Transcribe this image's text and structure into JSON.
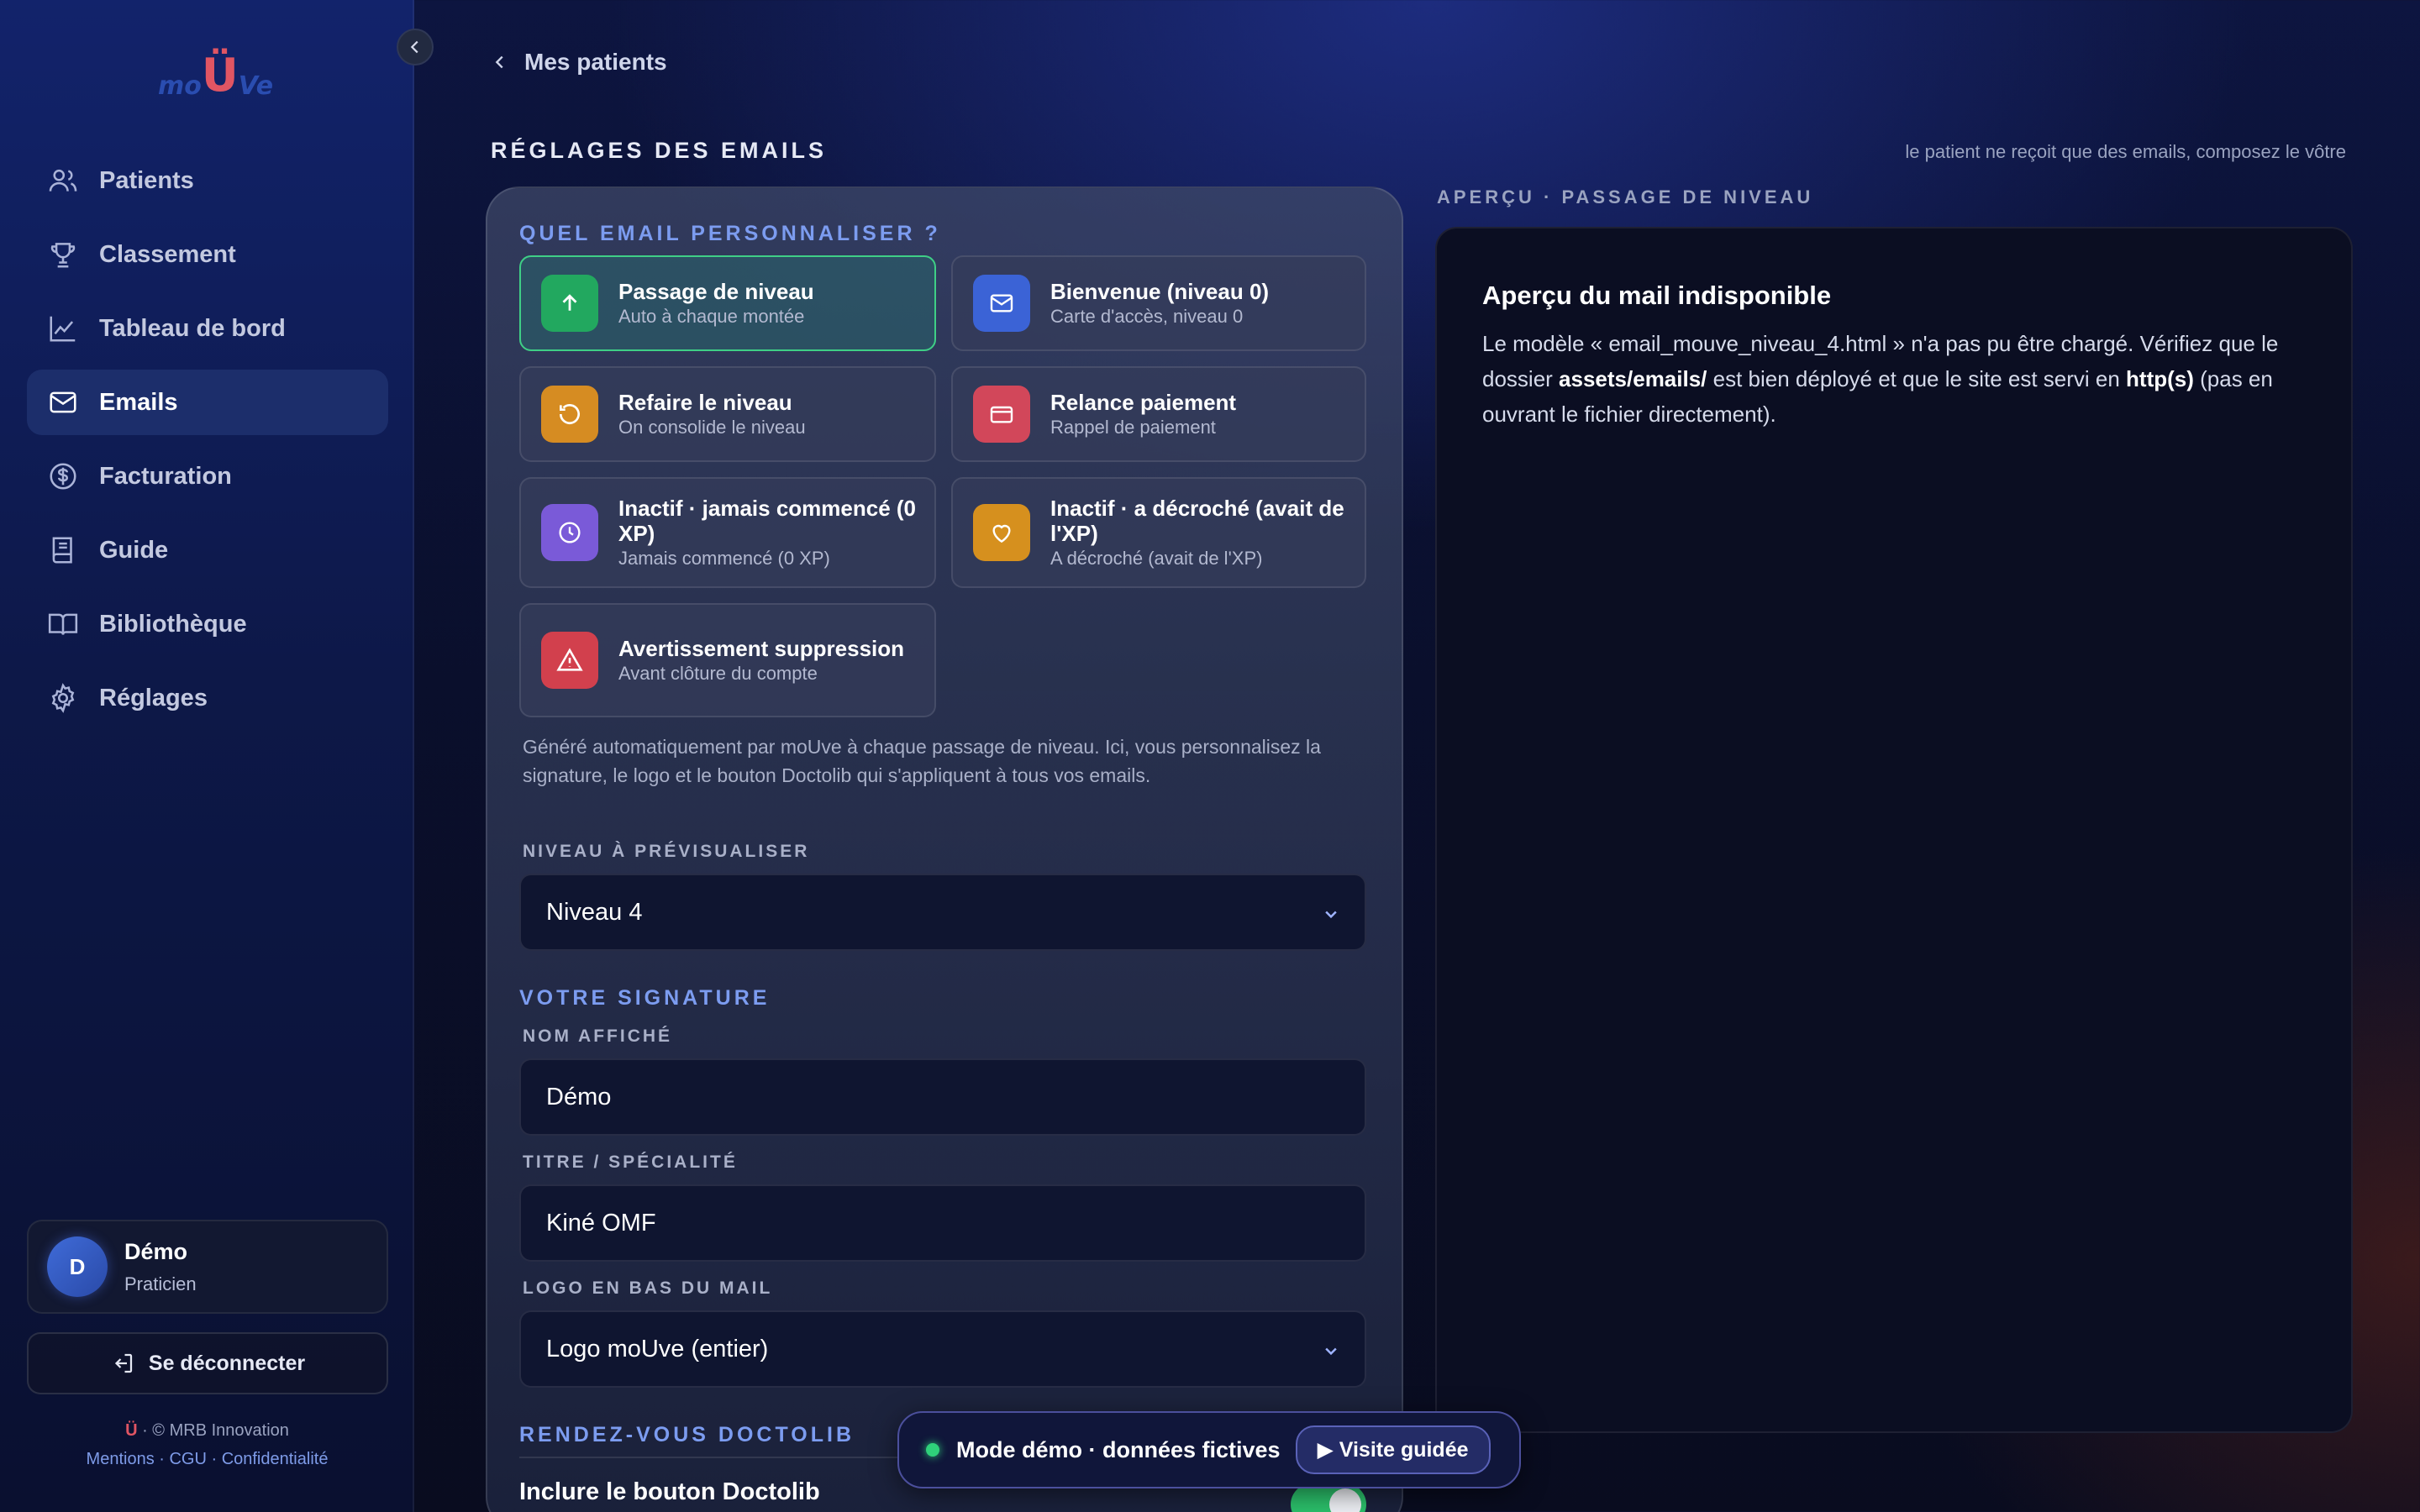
{
  "app": {
    "logo_text_left": "mo",
    "logo_text_mid": "Ü",
    "logo_text_right": "Ve"
  },
  "sidebar": {
    "items": [
      {
        "label": "Patients",
        "icon": "users-icon"
      },
      {
        "label": "Classement",
        "icon": "trophy-icon"
      },
      {
        "label": "Tableau de bord",
        "icon": "chart-icon"
      },
      {
        "label": "Emails",
        "icon": "mail-icon",
        "active": true
      },
      {
        "label": "Facturation",
        "icon": "dollar-icon"
      },
      {
        "label": "Guide",
        "icon": "book-icon"
      },
      {
        "label": "Bibliothèque",
        "icon": "open-book-icon"
      },
      {
        "label": "Réglages",
        "icon": "gear-icon"
      }
    ],
    "user": {
      "initial": "D",
      "name": "Démo",
      "role": "Praticien"
    },
    "logout": "Se déconnecter",
    "footer": {
      "copyright": "· © MRB Innovation",
      "links": "Mentions · CGU · Confidentialité"
    }
  },
  "header": {
    "back_label": "Mes patients",
    "title": "RÉGLAGES DES EMAILS",
    "hint": "le patient ne reçoit que des emails, composez le vôtre"
  },
  "section_choose": "QUEL EMAIL PERSONNALISER ?",
  "email_types": [
    {
      "title": "Passage de niveau",
      "sub": "Auto à chaque montée",
      "icon": "arrow-up-icon",
      "color": "#22a85f"
    },
    {
      "title": "Bienvenue (niveau 0)",
      "sub": "Carte d'accès, niveau 0",
      "icon": "mail-icon",
      "color": "#3b63d6"
    },
    {
      "title": "Refaire le niveau",
      "sub": "On consolide le niveau",
      "icon": "refresh-icon",
      "color": "#d68c22"
    },
    {
      "title": "Relance paiement",
      "sub": "Rappel de paiement",
      "icon": "card-icon",
      "color": "#d2475a"
    },
    {
      "title": "Inactif · jamais commencé (0 XP)",
      "sub": "Jamais commencé (0 XP)",
      "icon": "clock-icon",
      "color": "#7a5ad8"
    },
    {
      "title": "Inactif · a décroché (avait de l'XP)",
      "sub": "A décroché (avait de l'XP)",
      "icon": "heart-icon",
      "color": "#d6901e"
    },
    {
      "title": "Avertissement suppression",
      "sub": "Avant clôture du compte",
      "icon": "warning-icon",
      "color": "#d2404d"
    }
  ],
  "description": "Généré automatiquement par moUve à chaque passage de niveau. Ici, vous personnalisez la signature, le logo et le bouton Doctolib qui s'appliquent à tous vos emails.",
  "level": {
    "label": "NIVEAU À PRÉVISUALISER",
    "value": "Niveau 4"
  },
  "signature": {
    "title": "VOTRE SIGNATURE",
    "name_label": "NOM AFFICHÉ",
    "name_value": "Démo",
    "specialty_label": "TITRE / SPÉCIALITÉ",
    "specialty_value": "Kiné OMF",
    "logo_label": "LOGO EN BAS DU MAIL",
    "logo_value": "Logo moUve (entier)"
  },
  "doctolib": {
    "title": "RENDEZ-VOUS DOCTOLIB",
    "toggle_label": "Inclure le bouton Doctolib",
    "enabled": true
  },
  "preview": {
    "label": "APERÇU · PASSAGE DE NIVEAU",
    "title": "Aperçu du mail indisponible",
    "text1": "Le modèle « email_mouve_niveau_4.html » n'a pas pu être chargé. Vérifiez que le dossier ",
    "bold1": "assets/emails/",
    "text2": " est bien déployé et que le site est servi en ",
    "bold2": "http(s)",
    "text3": " (pas en ouvrant le fichier directement)."
  },
  "demo_banner": {
    "text": "Mode démo · données fictives",
    "button": "▶ Visite guidée"
  }
}
